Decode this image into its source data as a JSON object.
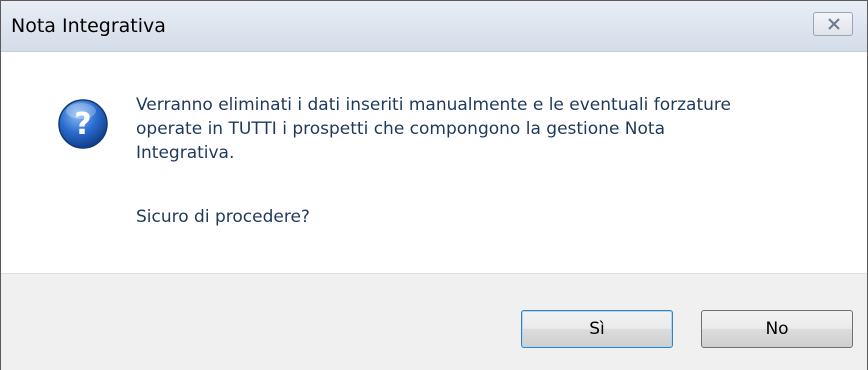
{
  "window": {
    "title": "Nota Integrativa"
  },
  "icons": {
    "close": "close-icon",
    "question": "question-icon"
  },
  "message": {
    "line1": "Verranno eliminati i dati inseriti manualmente  e le eventuali forzature",
    "line2": "operate in TUTTI i prospetti che compongono la gestione Nota",
    "line3": "Integrativa.",
    "question": "Sicuro di procedere?"
  },
  "buttons": {
    "yes_label": "Sì",
    "no_label": "No"
  },
  "colors": {
    "text": "#1e395b",
    "icon_blue": "#2b6ccf"
  }
}
